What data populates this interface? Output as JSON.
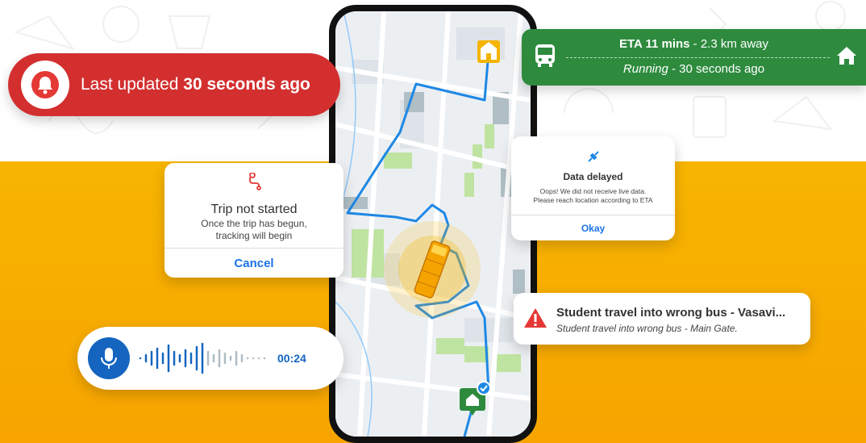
{
  "alert_pill": {
    "prefix": "Last updated ",
    "emphasis": "30 seconds ago",
    "icon": "bell-icon",
    "color": "#d32f2f"
  },
  "eta_card": {
    "eta_label": "ETA 11 mins",
    "distance": " - 2.3 km away",
    "status": "Running",
    "status_suffix": " - 30 seconds ago",
    "color": "#2e8b3e"
  },
  "trip_card": {
    "title": "Trip not started",
    "line1": "Once the trip has begun,",
    "line2": "tracking will begin",
    "button": "Cancel",
    "icon": "route-icon"
  },
  "delay_card": {
    "title": "Data delayed",
    "line1": "Oops! We did not receive live data.",
    "line2": "Please reach location according  to ETA",
    "button": "Okay",
    "icon": "plug-icon"
  },
  "wrong_bus": {
    "title": "Student travel into wrong bus - Vasavi...",
    "subtitle": "Student travel into wrong bus - Main Gate.",
    "icon": "warning-icon"
  },
  "voice_note": {
    "duration": "00:24",
    "icon": "microphone-icon"
  },
  "map": {
    "route_color": "#1e88e5",
    "school_icon": "school-icon",
    "home_icon": "home-pin-icon",
    "bus_icon": "school-bus-icon"
  }
}
